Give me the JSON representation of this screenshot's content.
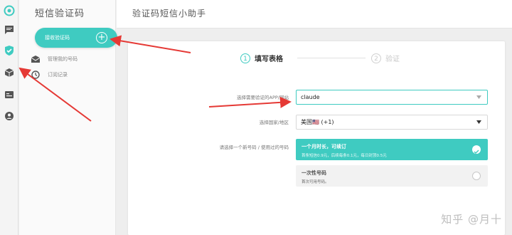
{
  "sidebar": {
    "title": "短信验证码",
    "receive_button": "接收验证码",
    "items": [
      {
        "label": "管理我的号码",
        "icon": "inbox-icon"
      },
      {
        "label": "订阅记录",
        "icon": "clock-icon"
      }
    ]
  },
  "rail_icons": [
    "logo-icon",
    "message-icon",
    "shield-check-icon",
    "box-icon",
    "contact-card-icon",
    "user-icon"
  ],
  "header": {
    "title": "验证码短信小助手"
  },
  "steps": [
    {
      "num": "1",
      "label": "填写表格",
      "active": true
    },
    {
      "num": "2",
      "label": "验证",
      "active": false
    }
  ],
  "form": {
    "app_label": "选择需要验证的APP/网站",
    "app_value": "claude",
    "country_label": "选择国家/地区",
    "country_value": "美国🇺🇸 (+1)",
    "number_label": "请选择一个新号码 / 使用过的号码",
    "options": [
      {
        "title": "一个月时长，可续订",
        "desc": "首条短信0.9元，后续每条0.1元，每日封顶0.5元",
        "selected": true
      },
      {
        "title": "一次性号码",
        "desc": "首次可用号码。",
        "selected": false
      }
    ]
  },
  "watermark": "知乎 @月十",
  "colors": {
    "accent": "#3fcbc1",
    "annotation_arrow": "#e53935"
  }
}
